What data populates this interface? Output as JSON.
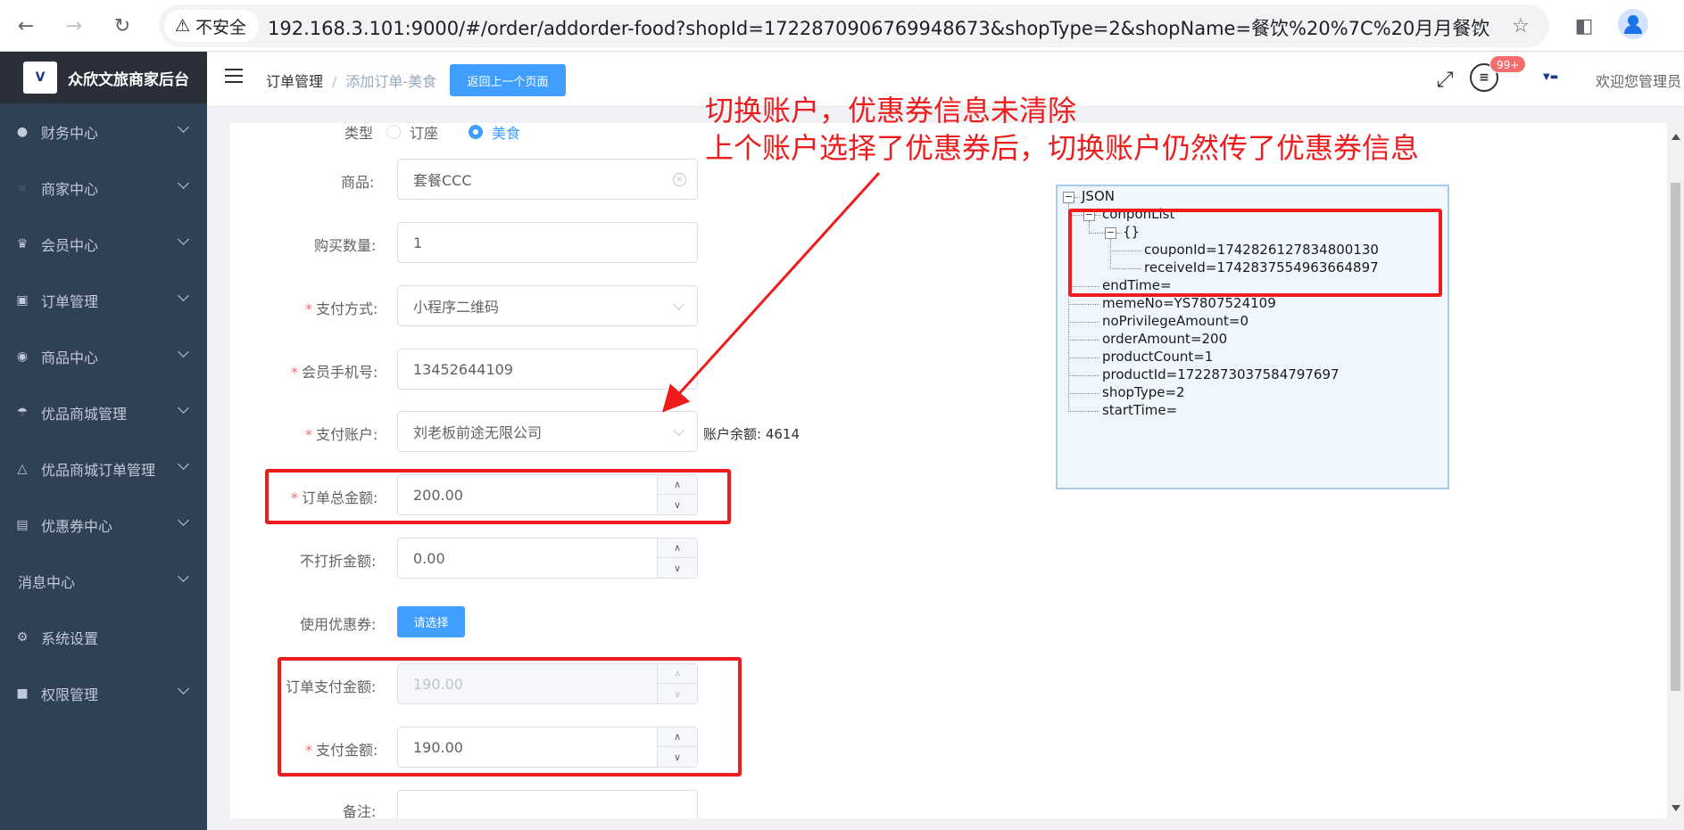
{
  "browser": {
    "security_label": "不安全",
    "url": "192.168.3.101:9000/#/order/addorder-food?shopId=1722870906769948673&shopType=2&shopName=餐饮%20%7C%20月月餐饮"
  },
  "app": {
    "title": "众欣文旅商家后台",
    "logo_text": "V"
  },
  "sidebar": {
    "items": [
      {
        "label": "财务中心",
        "icon": "money-bag-icon"
      },
      {
        "label": "商家中心",
        "icon": "merchant-icon"
      },
      {
        "label": "会员中心",
        "icon": "crown-icon"
      },
      {
        "label": "订单管理",
        "icon": "clipboard-icon"
      },
      {
        "label": "商品中心",
        "icon": "product-icon"
      },
      {
        "label": "优品商城管理",
        "icon": "mall-icon"
      },
      {
        "label": "优品商城订单管理",
        "icon": "mall-order-icon"
      },
      {
        "label": "优惠券中心",
        "icon": "ticket-icon"
      },
      {
        "label": "消息中心",
        "icon": ""
      },
      {
        "label": "系统设置",
        "icon": "gear-icon"
      },
      {
        "label": "权限管理",
        "icon": "lock-icon"
      }
    ]
  },
  "header": {
    "breadcrumb_1": "订单管理",
    "breadcrumb_sep": "/",
    "breadcrumb_2": "添加订单-美食",
    "back_button": "返回上一个页面",
    "badge": "99+",
    "welcome": "欢迎您管理员"
  },
  "form": {
    "type_label": "类型",
    "type_option_1": "订座",
    "type_option_2": "美食",
    "product_label": "商品:",
    "product_value": "套餐CCC",
    "quantity_label": "购买数量:",
    "quantity_value": "1",
    "payment_method_label": "支付方式:",
    "payment_method_value": "小程序二维码",
    "phone_label": "会员手机号:",
    "phone_value": "13452644109",
    "account_label": "支付账户:",
    "account_value": "刘老板前途无限公司",
    "balance_text": "账户余额:  4614",
    "order_total_label": "订单总金额:",
    "order_total_value": "200.00",
    "no_discount_label": "不打折金额:",
    "no_discount_value": "0.00",
    "coupon_label": "使用优惠券:",
    "coupon_button": "请选择",
    "order_pay_label": "订单支付金额:",
    "order_pay_value": "190.00",
    "pay_amount_label": "支付金额:",
    "pay_amount_value": "190.00",
    "remark_label": "备注:",
    "required_mark": "*"
  },
  "annotation": {
    "line1": "切换账户，优惠券信息未清除",
    "line2": "上个账户选择了优惠券后，切换账户仍然传了优惠券信息",
    "color": "#ee1c1c"
  },
  "json_tree": {
    "root": "JSON",
    "list_key": "conponList",
    "obj": "{}",
    "coupon_id": "couponId=1742826127834800130",
    "receive_id": "receiveId=1742837554963664897",
    "fields": [
      "endTime=",
      "memeNo=YS7807524109",
      "noPrivilegeAmount=0",
      "orderAmount=200",
      "productCount=1",
      "productId=1722873037584797697",
      "shopType=2",
      "startTime="
    ]
  }
}
